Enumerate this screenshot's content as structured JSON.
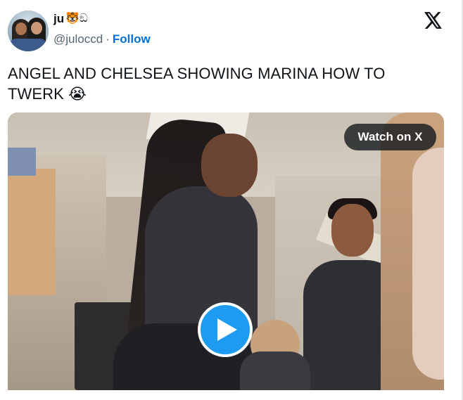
{
  "user": {
    "display_name": "ju",
    "name_emojis": "🐯ඞ",
    "handle": "@juloccd",
    "separator": "·",
    "follow_label": "Follow"
  },
  "tweet": {
    "text": "ANGEL AND CHELSEA SHOWING MARINA HOW TO TWERK 😭"
  },
  "media": {
    "watch_label": "Watch on X"
  },
  "icons": {
    "brand": "x-logo-icon",
    "play": "play-icon"
  },
  "colors": {
    "follow": "#006fd6",
    "play_button": "#1d9bf0",
    "text": "#0f1419",
    "secondary_text": "#536471"
  }
}
